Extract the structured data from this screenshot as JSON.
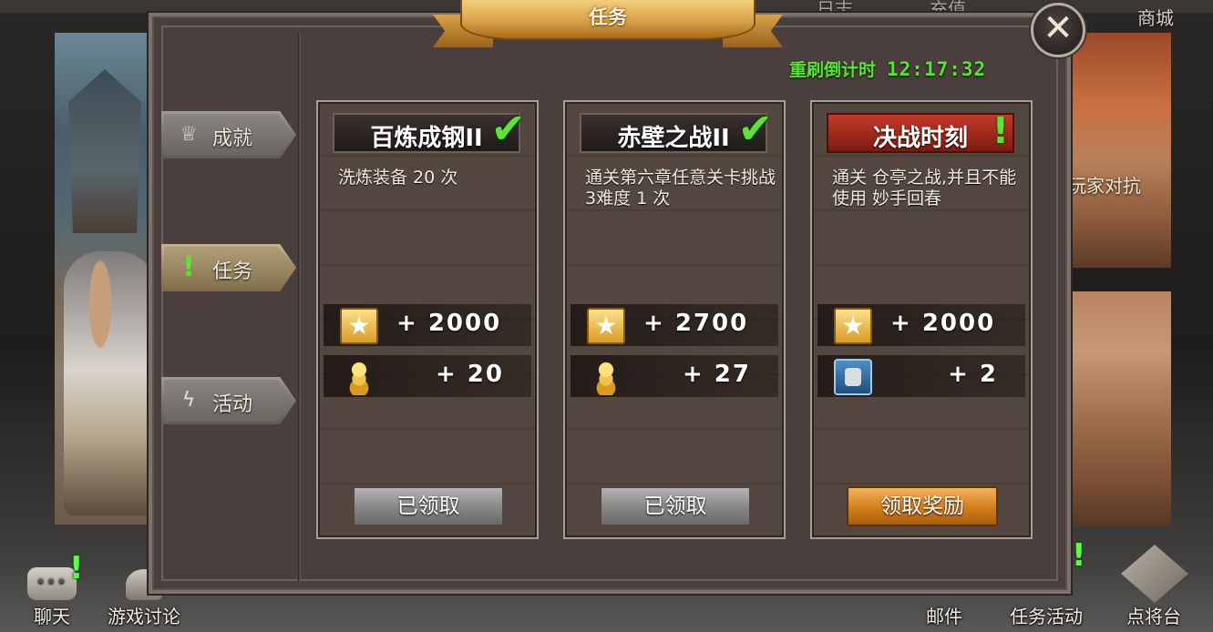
{
  "background": {
    "top_links": [
      "日志",
      "充值",
      "商城"
    ],
    "right_banner_text": "玩家对抗",
    "bottom_bar": {
      "chat": "聊天",
      "forum": "游戏讨论",
      "mail": "邮件",
      "task_activity": "任务活动",
      "recruit": "点将台"
    }
  },
  "dialog": {
    "title": "任务",
    "close_glyph": "✕",
    "refresh_label": "重刷倒计时",
    "refresh_time": "12:17:32",
    "tabs": [
      {
        "label": "成就",
        "icon": "crown-icon",
        "glyph": "♕",
        "active": false
      },
      {
        "label": "任务",
        "icon": "alert-icon",
        "glyph": "!",
        "active": true
      },
      {
        "label": "活动",
        "icon": "lightning-icon",
        "glyph": "ϟ",
        "active": false
      }
    ],
    "cards": [
      {
        "title": "百炼成钢II",
        "status": "completed",
        "description": "洗炼装备 20 次",
        "exp": "+ 2000",
        "second_reward": "+ 20",
        "second_reward_icon": "coins-icon",
        "button": "已领取"
      },
      {
        "title": "赤壁之战II",
        "status": "completed",
        "description": "通关第六章任意关卡挑战3难度 1 次",
        "exp": "+ 2700",
        "second_reward": "+ 27",
        "second_reward_icon": "coins-icon",
        "button": "已领取"
      },
      {
        "title": "决战时刻",
        "status": "claimable",
        "description": "通关 仓亭之战,并且不能使用 妙手回春",
        "exp": "+ 2000",
        "second_reward": "+ 2",
        "second_reward_icon": "token-icon",
        "button": "领取奖励"
      }
    ]
  },
  "colors": {
    "panel": "#4b3f3d",
    "ribbon_gold": "#d9a146",
    "countdown_green": "#57e534",
    "check_green": "#5ee23a",
    "claim_orange": "#d27e1c",
    "claimed_grey": "#8b8987",
    "alert_red": "#c43a2a"
  }
}
